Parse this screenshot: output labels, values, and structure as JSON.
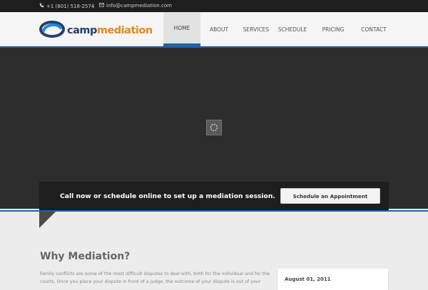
{
  "topbar": {
    "phone": "+1 (801) 518-2574",
    "separator": "|",
    "email": "info@campmediation.com"
  },
  "logo": {
    "camp": "camp",
    "mediation": "mediation"
  },
  "nav": {
    "items": [
      {
        "label": "HOME",
        "active": true
      },
      {
        "label": "ABOUT",
        "active": false
      },
      {
        "label": "SERVICES",
        "active": false
      },
      {
        "label": "SCHEDULE",
        "active": false
      },
      {
        "label": "PRICING",
        "active": false
      },
      {
        "label": "CONTACT",
        "active": false
      }
    ]
  },
  "cta": {
    "text": "Call now or schedule online to set up a mediation session.",
    "button": "Schedule an Appointment"
  },
  "why": {
    "title": "Why Mediation?",
    "text": "Family conflicts are some of the most difficult disputes to deal with, both for the individual and for the courts. Once you place your dispute in front of a judge, the outcome of your dispute is out of your"
  },
  "sidebar": {
    "date": "August 01, 2011"
  },
  "colors": {
    "accent": "#1f63a8",
    "logo_dark": "#263f6b",
    "logo_orange": "#e08a22"
  }
}
